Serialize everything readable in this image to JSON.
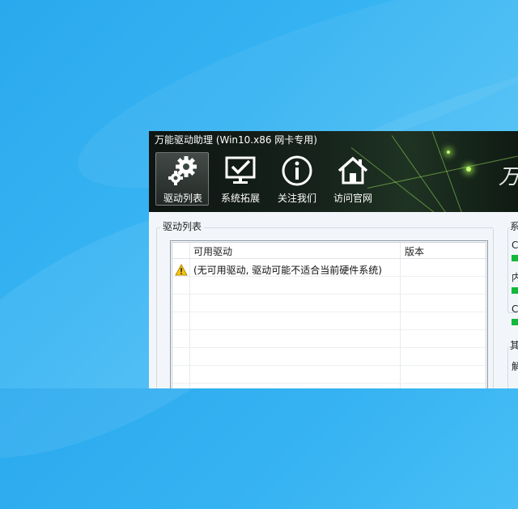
{
  "window": {
    "title": "万能驱动助理 (Win10.x86 网卡专用)",
    "brand_glyph": "万"
  },
  "toolbar": {
    "items": [
      {
        "label": "驱动列表",
        "icon": "gears-icon",
        "active": true
      },
      {
        "label": "系统拓展",
        "icon": "monitor-check-icon",
        "active": false
      },
      {
        "label": "关注我们",
        "icon": "info-icon",
        "active": false
      },
      {
        "label": "访问官网",
        "icon": "home-icon",
        "active": false
      }
    ]
  },
  "driver_list": {
    "group_title": "驱动列表",
    "columns": [
      "可用驱动",
      "版本"
    ],
    "rows": [
      {
        "icon": "warning-icon",
        "driver": "(无可用驱动, 驱动可能不适合当前硬件系统)",
        "version": ""
      }
    ]
  },
  "side_panel": {
    "group_title_fragment": "系",
    "labels": [
      "C",
      "内",
      "C"
    ],
    "second_group_fragment": "其",
    "second_label": "解",
    "accent_color": "#12b83a"
  }
}
